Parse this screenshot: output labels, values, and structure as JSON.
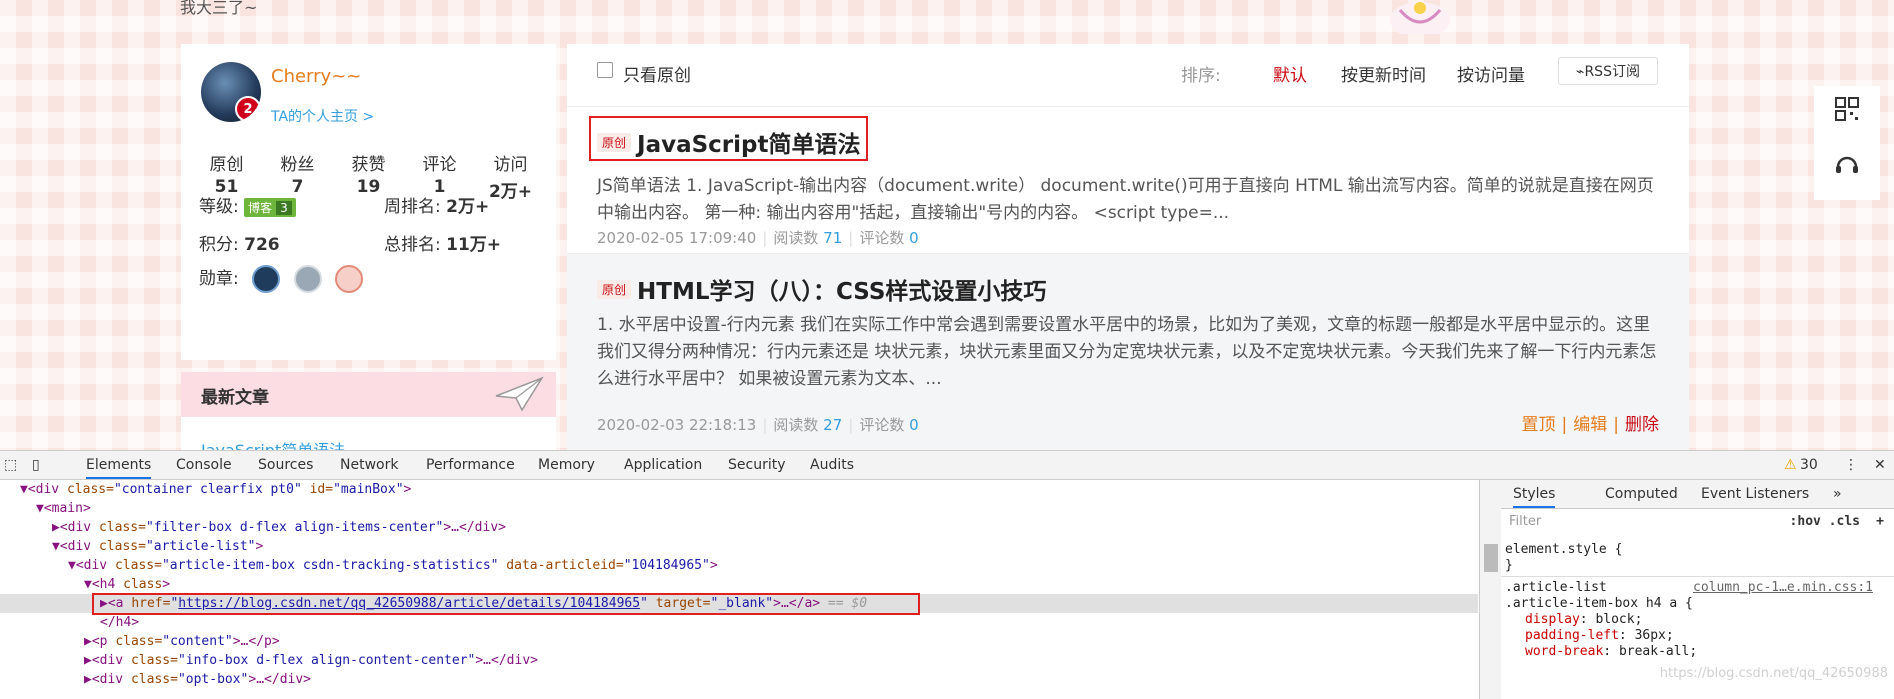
{
  "top": {
    "tagline": "我大三了~"
  },
  "profile": {
    "name": "Cherry~~",
    "level_badge": "2",
    "home_link": "TA的个人主页 >",
    "stats": [
      {
        "label": "原创",
        "value": "51"
      },
      {
        "label": "粉丝",
        "value": "7"
      },
      {
        "label": "获赞",
        "value": "19"
      },
      {
        "label": "评论",
        "value": "1"
      },
      {
        "label": "访问",
        "value": "2万+"
      }
    ],
    "grade_label": "等级:",
    "grade_badge": "博客",
    "grade_level": "3",
    "week_rank_label": "周排名:",
    "week_rank": "2万+",
    "points_label": "积分:",
    "points": "726",
    "total_rank_label": "总排名:",
    "total_rank": "11万+",
    "medals_label": "勋章:"
  },
  "latest": {
    "title": "最新文章",
    "first_link": "JavaScript简单语法"
  },
  "filter": {
    "original_only": "只看原创",
    "sort_label": "排序:",
    "sort_default": "默认",
    "sort_update": "按更新时间",
    "sort_visit": "按访问量",
    "rss": "RSS订阅"
  },
  "articles": [
    {
      "tag": "原创",
      "title": "JavaScript简单语法",
      "content": "JS简单语法 1. JavaScript-输出内容（document.write） document.write()可用于直接向 HTML 输出流写内容。简单的说就是直接在网页中输出内容。 第一种: 输出内容用\"括起，直接输出\"号内的内容。 <script type=...",
      "date": "2020-02-05 17:09:40",
      "reads_label": "阅读数",
      "reads": "71",
      "comments_label": "评论数",
      "comments": "0"
    },
    {
      "tag": "原创",
      "title": "HTML学习（八）：CSS样式设置小技巧",
      "content": "1. 水平居中设置-行内元素 我们在实际工作中常会遇到需要设置水平居中的场景，比如为了美观，文章的标题一般都是水平居中显示的。这里我们又得分两种情况：行内元素还是 块状元素，块状元素里面又分为定宽块状元素，以及不定宽块状元素。今天我们先来了解一下行内元素怎么进行水平居中？ 如果被设置元素为文本、...",
      "date": "2020-02-03 22:18:13",
      "reads_label": "阅读数",
      "reads": "27",
      "comments_label": "评论数",
      "comments": "0",
      "actions": {
        "top": "置顶",
        "edit": "编辑",
        "delete": "删除"
      }
    }
  ],
  "devtools": {
    "tabs": [
      "Elements",
      "Console",
      "Sources",
      "Network",
      "Performance",
      "Memory",
      "Application",
      "Security",
      "Audits"
    ],
    "warnings": "30",
    "dom": {
      "l1_tag": "<div ",
      "l1_attr1": "class=",
      "l1_val1": "\"container clearfix pt0\"",
      "l1_attr2": " id=",
      "l1_val2": "\"mainBox\"",
      "l1_end": ">",
      "l2": "<main>",
      "l3_a": "<div ",
      "l3_b": "class=",
      "l3_c": "\"filter-box d-flex align-items-center\"",
      "l3_d": ">…</div>",
      "l4_a": "<div ",
      "l4_b": "class=",
      "l4_c": "\"article-list\"",
      "l4_d": ">",
      "l5_a": "<div ",
      "l5_b": "class=",
      "l5_c": "\"article-item-box csdn-tracking-statistics\"",
      "l5_d": " data-articleid=",
      "l5_e": "\"104184965\"",
      "l5_f": ">",
      "l6_a": "<h4 ",
      "l6_b": "class",
      "l6_c": ">",
      "l7_a": "<a ",
      "l7_b": "href=",
      "l7_q1": "\"",
      "l7_link": "https://blog.csdn.net/qq_42650988/article/details/104184965",
      "l7_q2": "\"",
      "l7_c": " target=",
      "l7_d": "\"_blank\"",
      "l7_e": ">…</a>",
      "l7_eq": " == $0",
      "l8": "</h4>",
      "l9_a": "<p ",
      "l9_b": "class=",
      "l9_c": "\"content\"",
      "l9_d": ">…</p>",
      "l10_a": "<div ",
      "l10_b": "class=",
      "l10_c": "\"info-box d-flex align-content-center\"",
      "l10_d": ">…</div>",
      "l11_a": "<div ",
      "l11_b": "class=",
      "l11_c": "\"opt-box\"",
      "l11_d": ">…</div>"
    },
    "styles_tabs": [
      "Styles",
      "Computed",
      "Event Listeners"
    ],
    "filter_placeholder": "Filter",
    "hov": ":hov  .cls",
    "css": {
      "element_style": "element.style {",
      "close": "}",
      "rule_sel1": ".article-list",
      "rule_src": "column_pc-1…e.min.css:1",
      "rule_sel2": ".article-item-box h4 a {",
      "p1_name": "display",
      "p1_val": "block;",
      "p2_name": "padding-left",
      "p2_val": "36px;",
      "p3_name": "word-break",
      "p3_val": "break-all;"
    },
    "watermark": "https://blog.csdn.net/qq_42650988"
  }
}
